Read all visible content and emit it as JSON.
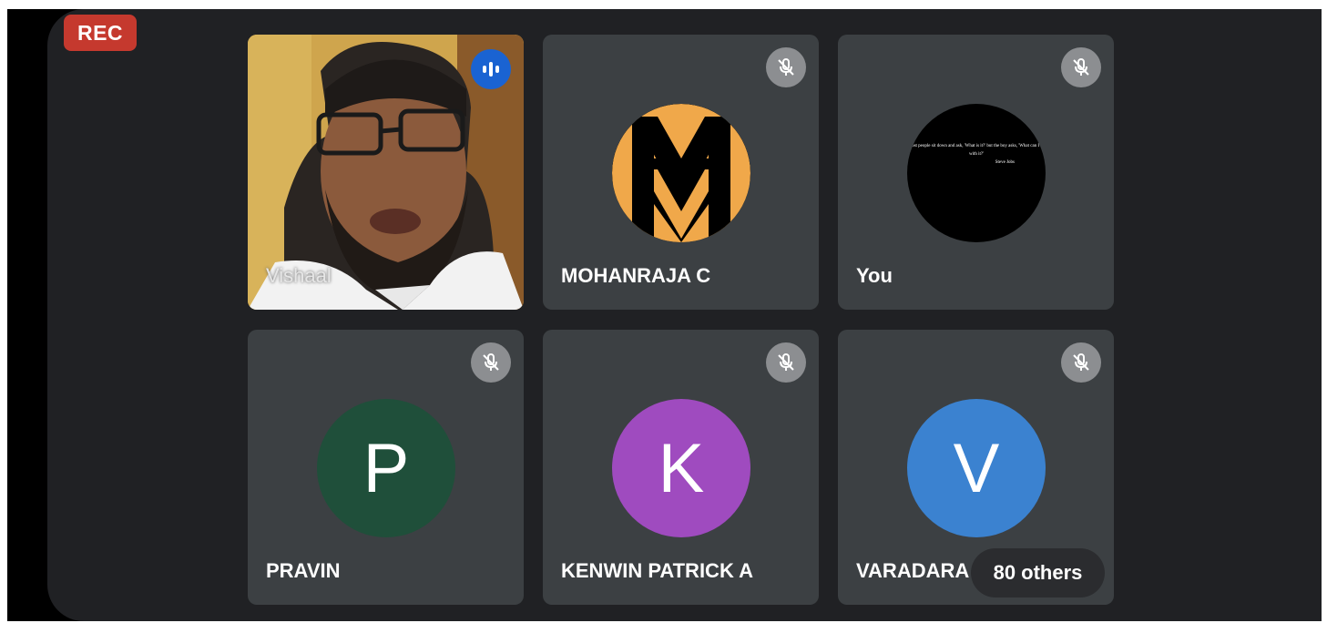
{
  "recording": {
    "label": "REC"
  },
  "participants": [
    {
      "name": "Vishaal",
      "type": "video",
      "speaking": true
    },
    {
      "name": "MOHANRAJA C",
      "type": "logo",
      "muted": true,
      "logo": "M-monogram-icon"
    },
    {
      "name": "You",
      "type": "image",
      "muted": true,
      "quote": "Most people sit down and ask, 'What is it?' but the boy asks, 'What can I do with it?'",
      "quote_author": "Steve Jobs"
    },
    {
      "name": "PRAVIN",
      "type": "initial",
      "initial": "P",
      "color": "#1f4f3a",
      "muted": true
    },
    {
      "name": "KENWIN PATRICK A",
      "type": "initial",
      "initial": "K",
      "color": "#9f4bbf",
      "muted": true
    },
    {
      "name": "VARADARA",
      "type": "initial",
      "initial": "V",
      "color": "#3b82d0",
      "muted": true
    }
  ],
  "others": {
    "label": "80 others"
  },
  "colors": {
    "stage": "#202124",
    "tile": "#3c4043",
    "rec": "#c5392e",
    "speaking": "#1a63d2",
    "logo_orange": "#f0a84a"
  }
}
